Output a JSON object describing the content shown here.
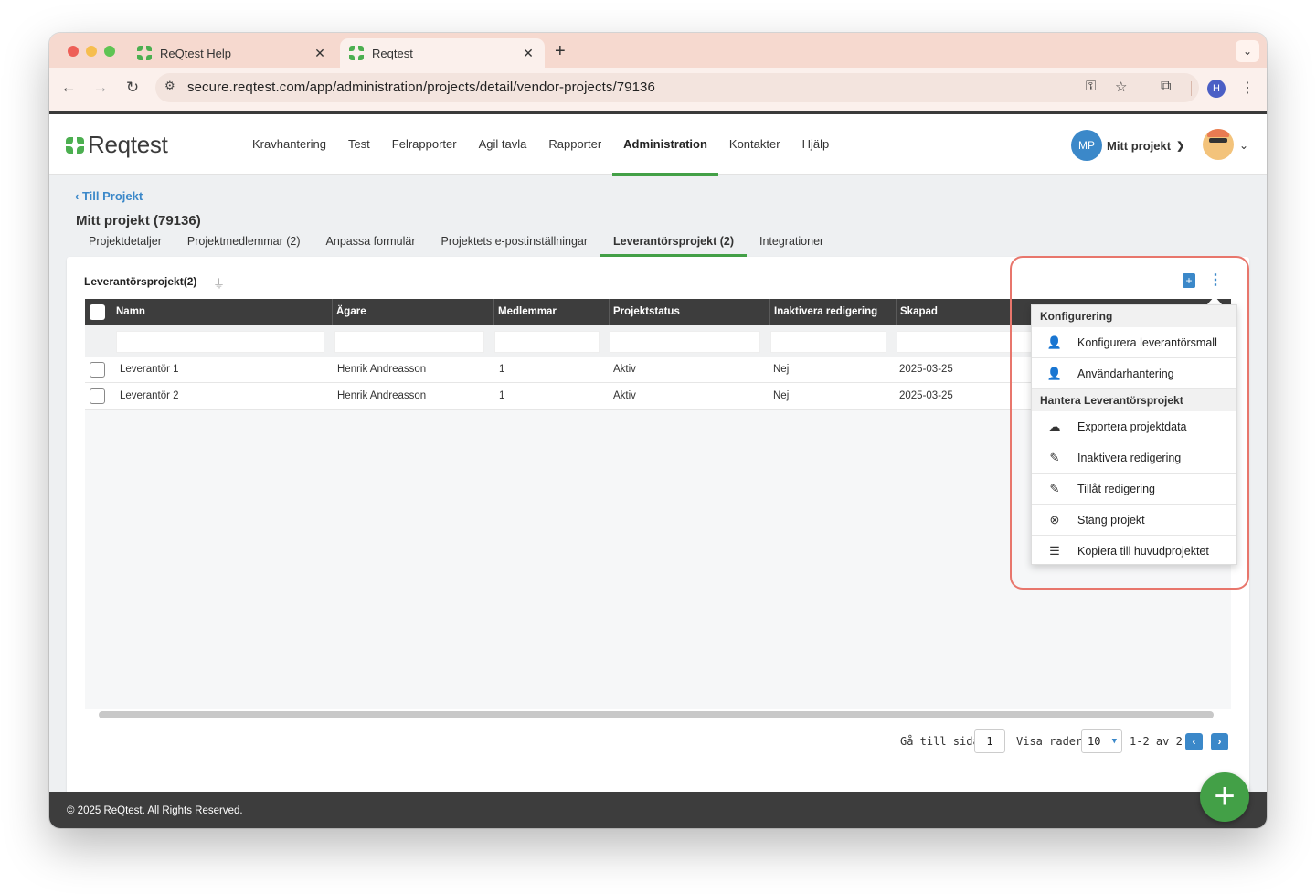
{
  "browser": {
    "tabs": [
      {
        "title": "ReQtest Help",
        "active": false
      },
      {
        "title": "Reqtest",
        "active": true
      }
    ],
    "url": "secure.reqtest.com/app/administration/projects/detail/vendor-projects/79136",
    "profile_initial": "H"
  },
  "app": {
    "logo_text": "Reqtest",
    "nav": [
      "Kravhantering",
      "Test",
      "Felrapporter",
      "Agil tavla",
      "Rapporter",
      "Administration",
      "Kontakter",
      "Hjälp"
    ],
    "nav_active": "Administration",
    "project_initials": "MP",
    "project_name": "Mitt projekt"
  },
  "page": {
    "back_link": "Till Projekt",
    "title": "Mitt projekt (79136)",
    "subtabs": [
      "Projektdetaljer",
      "Projektmedlemmar (2)",
      "Anpassa formulär",
      "Projektets e-postinställningar",
      "Leverantörsprojekt (2)",
      "Integrationer"
    ],
    "subtab_active": "Leverantörsprojekt (2)"
  },
  "grid": {
    "title": "Leverantörsprojekt(2)",
    "columns": [
      "Namn",
      "Ägare",
      "Medlemmar",
      "Projektstatus",
      "Inaktivera redigering",
      "Skapad"
    ],
    "rows": [
      [
        "Leverantör 1",
        "Henrik Andreasson",
        "1",
        "Aktiv",
        "Nej",
        "2025-03-25"
      ],
      [
        "Leverantör 2",
        "Henrik Andreasson",
        "1",
        "Aktiv",
        "Nej",
        "2025-03-25"
      ]
    ]
  },
  "pager": {
    "goto_label": "Gå till sidan:",
    "page": "1",
    "rows_label": "Visa rader:",
    "rows_per_page": "10",
    "range": "1-2 av 2"
  },
  "menu": {
    "section1": "Konfigurering",
    "items1": [
      {
        "label": "Konfigurera leverantörsmall",
        "icon": "user-cog-icon"
      },
      {
        "label": "Användarhantering",
        "icon": "user-plus-icon"
      }
    ],
    "section2": "Hantera Leverantörsprojekt",
    "items2": [
      {
        "label": "Exportera projektdata",
        "icon": "cloud-upload-icon"
      },
      {
        "label": "Inaktivera redigering",
        "icon": "pencil-slash-icon"
      },
      {
        "label": "Tillåt redigering",
        "icon": "pencil-icon"
      },
      {
        "label": "Stäng projekt",
        "icon": "close-project-icon"
      },
      {
        "label": "Kopiera till huvudprojektet",
        "icon": "layers-icon"
      }
    ]
  },
  "footer": "© 2025 ReQtest. All Rights Reserved.",
  "colors": {
    "accent": "#3b88c9",
    "green": "#43a047",
    "highlight": "#e8766c"
  }
}
